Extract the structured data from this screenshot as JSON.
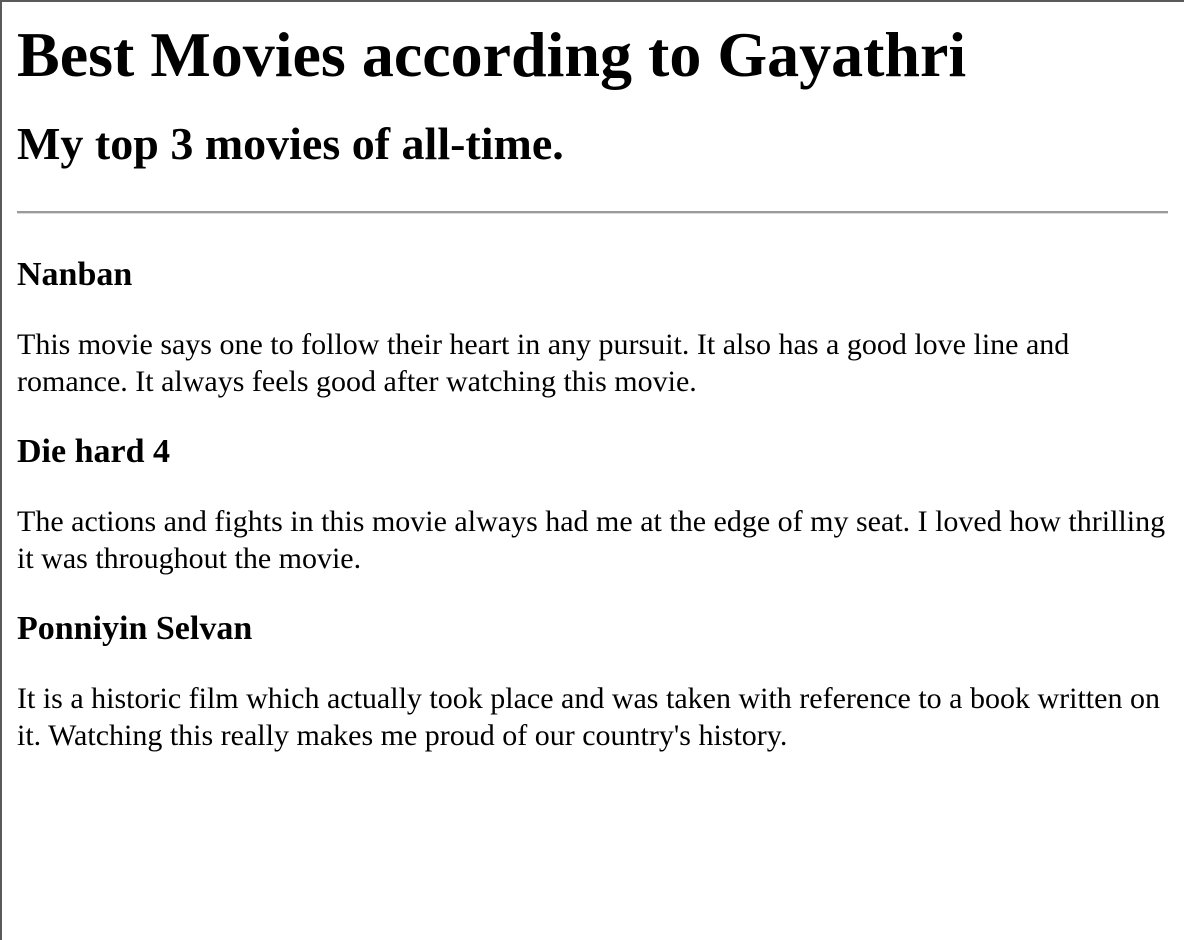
{
  "header": {
    "title": "Best Movies according to Gayathri",
    "subtitle": "My top 3 movies of all-time."
  },
  "movies": [
    {
      "title": "Nanban",
      "description": "This movie says one to follow their heart in any pursuit. It also has a good love line and romance. It always feels good after watching this movie."
    },
    {
      "title": "Die hard 4",
      "description": "The actions and fights in this movie always had me at the edge of my seat. I loved how thrilling it was throughout the movie."
    },
    {
      "title": "Ponniyin Selvan",
      "description": "It is a historic film which actually took place and was taken with reference to a book written on it. Watching this really makes me proud of our country's history."
    }
  ]
}
